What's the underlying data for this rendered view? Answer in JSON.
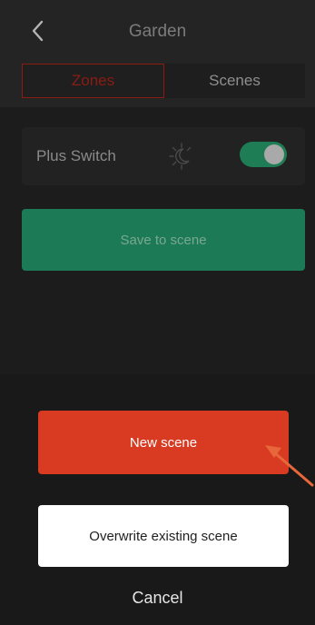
{
  "header": {
    "title": "Garden",
    "back_icon": "chevron-left-icon"
  },
  "tabs": [
    {
      "label": "Zones",
      "active": true
    },
    {
      "label": "Scenes",
      "active": false
    }
  ],
  "zone_item": {
    "label": "Plus Switch",
    "icon": "sun-moon-icon",
    "toggle_on": true
  },
  "save_button": {
    "label": "Save to scene"
  },
  "sheet": {
    "new_scene_label": "New scene",
    "overwrite_label": "Overwrite existing scene",
    "cancel_label": "Cancel"
  },
  "colors": {
    "accent_red": "#d83b22",
    "accent_green": "#1c7a56",
    "arrow": "#e8673a"
  }
}
